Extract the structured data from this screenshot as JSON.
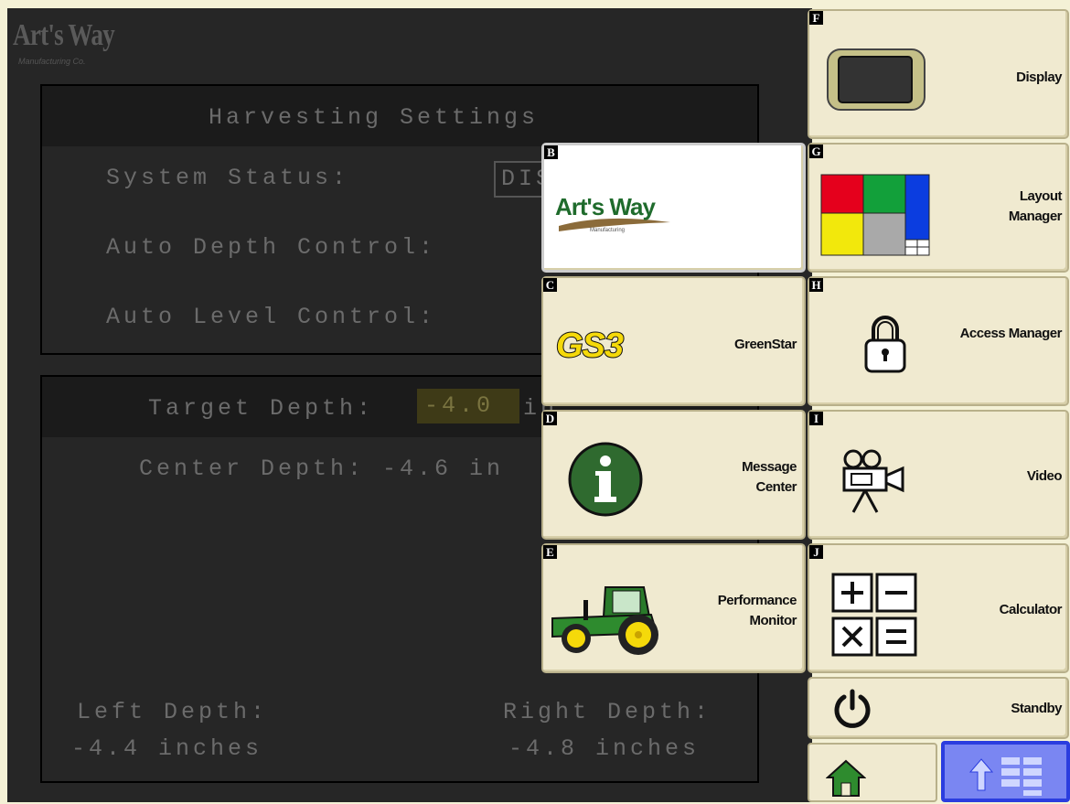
{
  "background": {
    "logo_text": "Art's Way",
    "logo_sub": "Manufacturing Co.",
    "harvest_title": "Harvesting Settings",
    "system_status_label": "System Status:",
    "system_status_value": "DIS",
    "auto_depth_label": "Auto Depth Control:",
    "auto_level_label": "Auto Level Control:",
    "target_depth_label": "Target Depth:",
    "target_depth_value": "-4.0",
    "target_depth_unit": "in",
    "center_depth": "Center Depth: -4.6 in",
    "left_depth_label": "Left Depth:",
    "left_depth_value": "-4.4 inches",
    "right_depth_label": "Right Depth:",
    "right_depth_value": "-4.8 inches"
  },
  "menu": {
    "tiles": [
      {
        "key": "F",
        "label": "Display",
        "icon": "display-icon"
      },
      {
        "key": "B",
        "label": "Art's Way",
        "sub": "Manufacturing",
        "icon": "artsway-logo"
      },
      {
        "key": "G",
        "label": "Layout Manager",
        "label_line1": "Layout",
        "label_line2": "Manager",
        "icon": "layout-grid-icon"
      },
      {
        "key": "C",
        "label": "GreenStar",
        "badge": "GS3",
        "icon": "gs3-logo"
      },
      {
        "key": "H",
        "label": "Access Manager",
        "icon": "padlock-icon"
      },
      {
        "key": "D",
        "label": "Message Center",
        "label_line1": "Message",
        "label_line2": "Center",
        "icon": "info-icon"
      },
      {
        "key": "I",
        "label": "Video",
        "icon": "video-camera-icon"
      },
      {
        "key": "E",
        "label": "Performance Monitor",
        "label_line1": "Performance",
        "label_line2": "Monitor",
        "icon": "tractor-icon"
      },
      {
        "key": "J",
        "label": "Calculator",
        "icon": "calculator-icon"
      }
    ],
    "standby_label": "Standby",
    "home_icon": "home-icon",
    "menu_icon": "up-arrow-menu-icon"
  },
  "colors": {
    "tile_bg": "#f0ead0",
    "bg_dark": "#262626",
    "nav_selected": "#6b7cf0",
    "green_accent": "#2e7d32",
    "yellow_accent": "#f5d90a"
  }
}
